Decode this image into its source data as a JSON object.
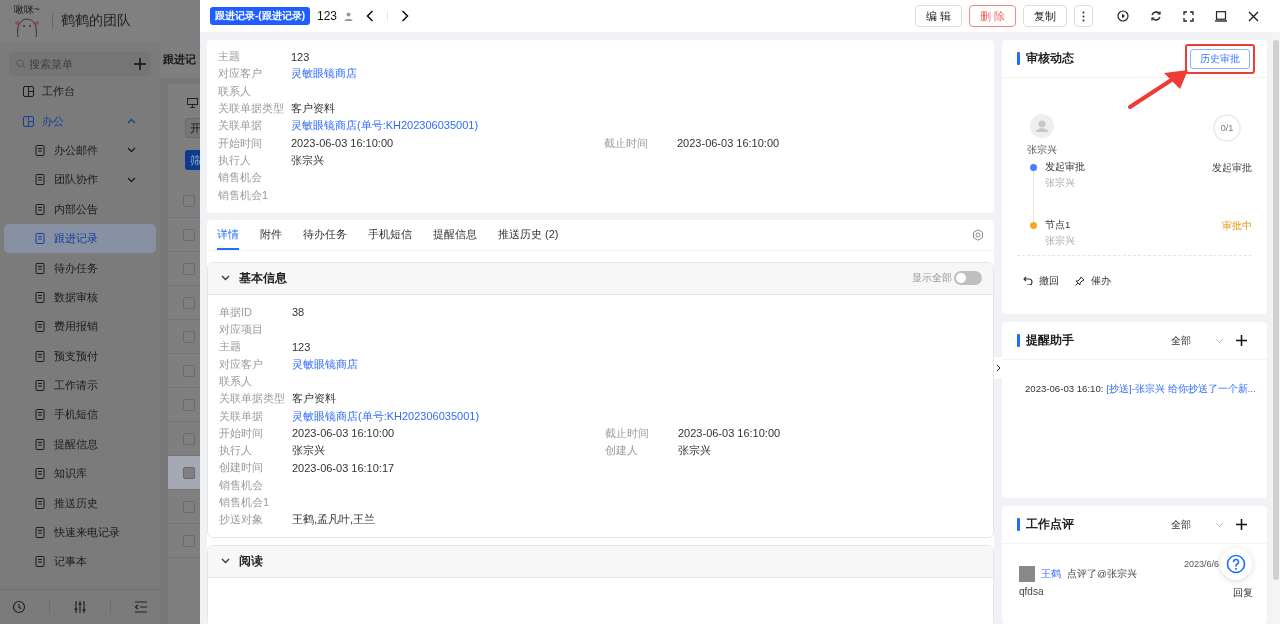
{
  "sidebar": {
    "logo_text": "啾咪~",
    "team_name": "鹤鹤的团队",
    "search": {
      "placeholder": "搜索菜单"
    },
    "items": [
      {
        "label": "工作台",
        "selected": false
      },
      {
        "label": "办公",
        "selected": false,
        "expanded": true,
        "children": [
          {
            "label": "办公邮件",
            "selected": false,
            "expanded": false
          },
          {
            "label": "团队协作",
            "selected": false,
            "expanded": false
          },
          {
            "label": "内部公告",
            "selected": false
          },
          {
            "label": "跟进记录",
            "selected": true
          },
          {
            "label": "待办任务",
            "selected": false
          },
          {
            "label": "数据审核",
            "selected": false
          },
          {
            "label": "费用报销",
            "selected": false
          },
          {
            "label": "预支预付",
            "selected": false
          },
          {
            "label": "工作请示",
            "selected": false
          },
          {
            "label": "手机短信",
            "selected": false
          },
          {
            "label": "提醒信息",
            "selected": false
          },
          {
            "label": "知识库",
            "selected": false
          },
          {
            "label": "推送历史",
            "selected": false
          },
          {
            "label": "快速来电记录",
            "selected": false
          },
          {
            "label": "记事本",
            "selected": false
          }
        ]
      }
    ]
  },
  "background_page": {
    "title": "跟进记",
    "buttons": [
      "开",
      "筛"
    ],
    "rows": [
      {
        "checked": false,
        "selected": false
      },
      {
        "checked": false,
        "selected": false
      },
      {
        "checked": false,
        "selected": false
      },
      {
        "checked": false,
        "selected": false
      },
      {
        "checked": false,
        "selected": false
      },
      {
        "checked": false,
        "selected": false
      },
      {
        "checked": false,
        "selected": false
      },
      {
        "checked": false,
        "selected": false
      },
      {
        "checked": false,
        "selected": true
      },
      {
        "checked": false,
        "selected": false
      },
      {
        "checked": false,
        "selected": false
      }
    ]
  },
  "drawer": {
    "tag": "跟进记录-(跟进记录)",
    "record_no": "123",
    "actions": [
      {
        "label": "编 辑",
        "kind": "normal"
      },
      {
        "label": "删 除",
        "kind": "danger"
      },
      {
        "label": "复制",
        "kind": "normal"
      }
    ]
  },
  "summary": {
    "rows": [
      [
        {
          "label": "主题",
          "value": "123",
          "link": false
        }
      ],
      [
        {
          "label": "对应客户",
          "value": "灵敏眼镜商店",
          "link": true
        }
      ],
      [
        {
          "label": "联系人"
        }
      ],
      [
        {
          "label": "关联单据类型",
          "value": "客户资料",
          "link": false
        }
      ],
      [
        {
          "label": "关联单据",
          "value": "灵敏眼镜商店(单号:KH202306035001)",
          "link": true
        }
      ],
      [
        {
          "label": "开始时间",
          "value": "2023-06-03 16:10:00",
          "link": false
        },
        {
          "label": "截止时间",
          "value": "2023-06-03 16:10:00",
          "link": false
        }
      ],
      [
        {
          "label": "执行人",
          "value": "张宗兴",
          "link": false
        }
      ],
      [
        {
          "label": "销售机会"
        }
      ],
      [
        {
          "label": "销售机会1"
        }
      ]
    ]
  },
  "tabs": [
    {
      "label": "详情",
      "selected": true
    },
    {
      "label": "附件",
      "selected": false
    },
    {
      "label": "待办任务",
      "selected": false
    },
    {
      "label": "手机短信",
      "selected": false
    },
    {
      "label": "提醒信息",
      "selected": false
    },
    {
      "label": "推送历史 (2)",
      "selected": false
    }
  ],
  "sections": [
    {
      "title": "基本信息",
      "expanded": true,
      "toggle": {
        "label": "显示全部",
        "on": false
      },
      "rows": [
        [
          {
            "label": "单据ID",
            "value": "38",
            "link": false
          }
        ],
        [
          {
            "label": "对应项目"
          }
        ],
        [
          {
            "label": "主题",
            "value": "123",
            "link": false
          }
        ],
        [
          {
            "label": "对应客户",
            "value": "灵敏眼镜商店",
            "link": true
          }
        ],
        [
          {
            "label": "联系人"
          }
        ],
        [
          {
            "label": "关联单据类型",
            "value": "客户资料",
            "link": false
          }
        ],
        [
          {
            "label": "关联单据",
            "value": "灵敏眼镜商店(单号:KH202306035001)",
            "link": true
          }
        ],
        [
          {
            "label": "开始时间",
            "value": "2023-06-03 16:10:00",
            "link": false
          },
          {
            "label": "截止时间",
            "value": "2023-06-03 16:10:00",
            "link": false
          }
        ],
        [
          {
            "label": "执行人",
            "value": "张宗兴",
            "link": false
          },
          {
            "label": "创建人",
            "value": "张宗兴",
            "link": false
          }
        ],
        [
          {
            "label": "创建时间",
            "value": "2023-06-03 16:10:17",
            "link": false
          }
        ],
        [
          {
            "label": "销售机会"
          }
        ],
        [
          {
            "label": "销售机会1"
          }
        ],
        [
          {
            "label": "抄送对象",
            "value": "王鹤,孟凡叶,王兰",
            "link": false
          }
        ]
      ]
    },
    {
      "title": "阅读",
      "expanded": true
    }
  ],
  "approval": {
    "title": "审核动态",
    "history_button": "历史审批",
    "applicant": "张宗兴",
    "count": "0/1",
    "steps": [
      {
        "title": "发起审批",
        "person": "张宗兴",
        "status": "发起审批",
        "kind": "started",
        "color": "#4f7cff"
      },
      {
        "title": "节点1",
        "person": "张宗兴",
        "status": "审批中",
        "kind": "pending",
        "color": "#f5a623"
      }
    ],
    "actions": [
      "撤回",
      "催办"
    ]
  },
  "reminders": {
    "title": "提醒助手",
    "filter": "全部",
    "items": [
      {
        "time": "2023-06-03 16:10:",
        "text": "[抄送]-张宗兴 给你抄送了一个新..."
      }
    ]
  },
  "comments": {
    "title": "工作点评",
    "filter": "全部",
    "items": [
      {
        "author": "王鹤",
        "action": "点评了@张宗兴",
        "date": "2023/6/6",
        "text": "qfdsa",
        "reply": "回复"
      }
    ]
  }
}
